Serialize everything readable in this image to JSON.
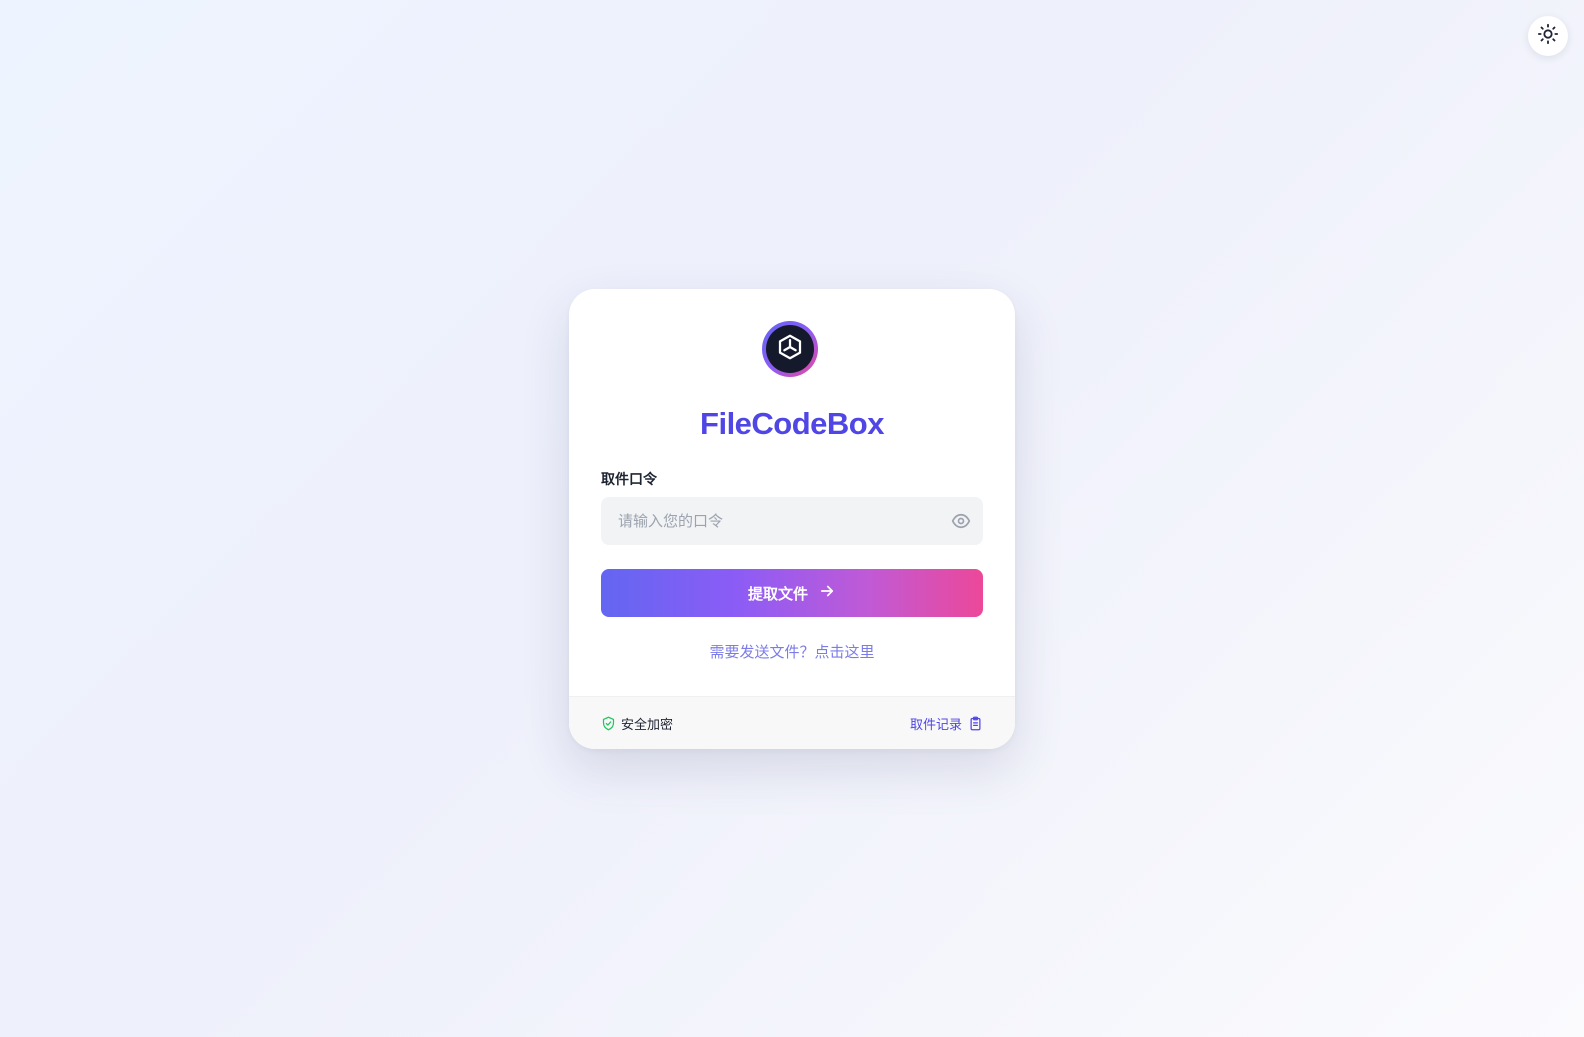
{
  "theme_toggle": {
    "icon": "sun-icon"
  },
  "card": {
    "logo_icon": "cube-icon",
    "title": "FileCodeBox",
    "code_label": "取件口令",
    "code_input": {
      "placeholder": "请输入您的口令",
      "value": ""
    },
    "visibility_icon": "eye-icon",
    "submit_label": "提取文件",
    "submit_icon": "arrow-right-icon",
    "send_link": "需要发送文件？点击这里"
  },
  "footer": {
    "secure_icon": "shield-check-icon",
    "secure_label": "安全加密",
    "records_label": "取件记录",
    "records_icon": "clipboard-icon"
  },
  "colors": {
    "accent": "#4f46e5",
    "gradient_start": "#6366f1",
    "gradient_end": "#ec4899",
    "secure_green": "#22c55e"
  }
}
